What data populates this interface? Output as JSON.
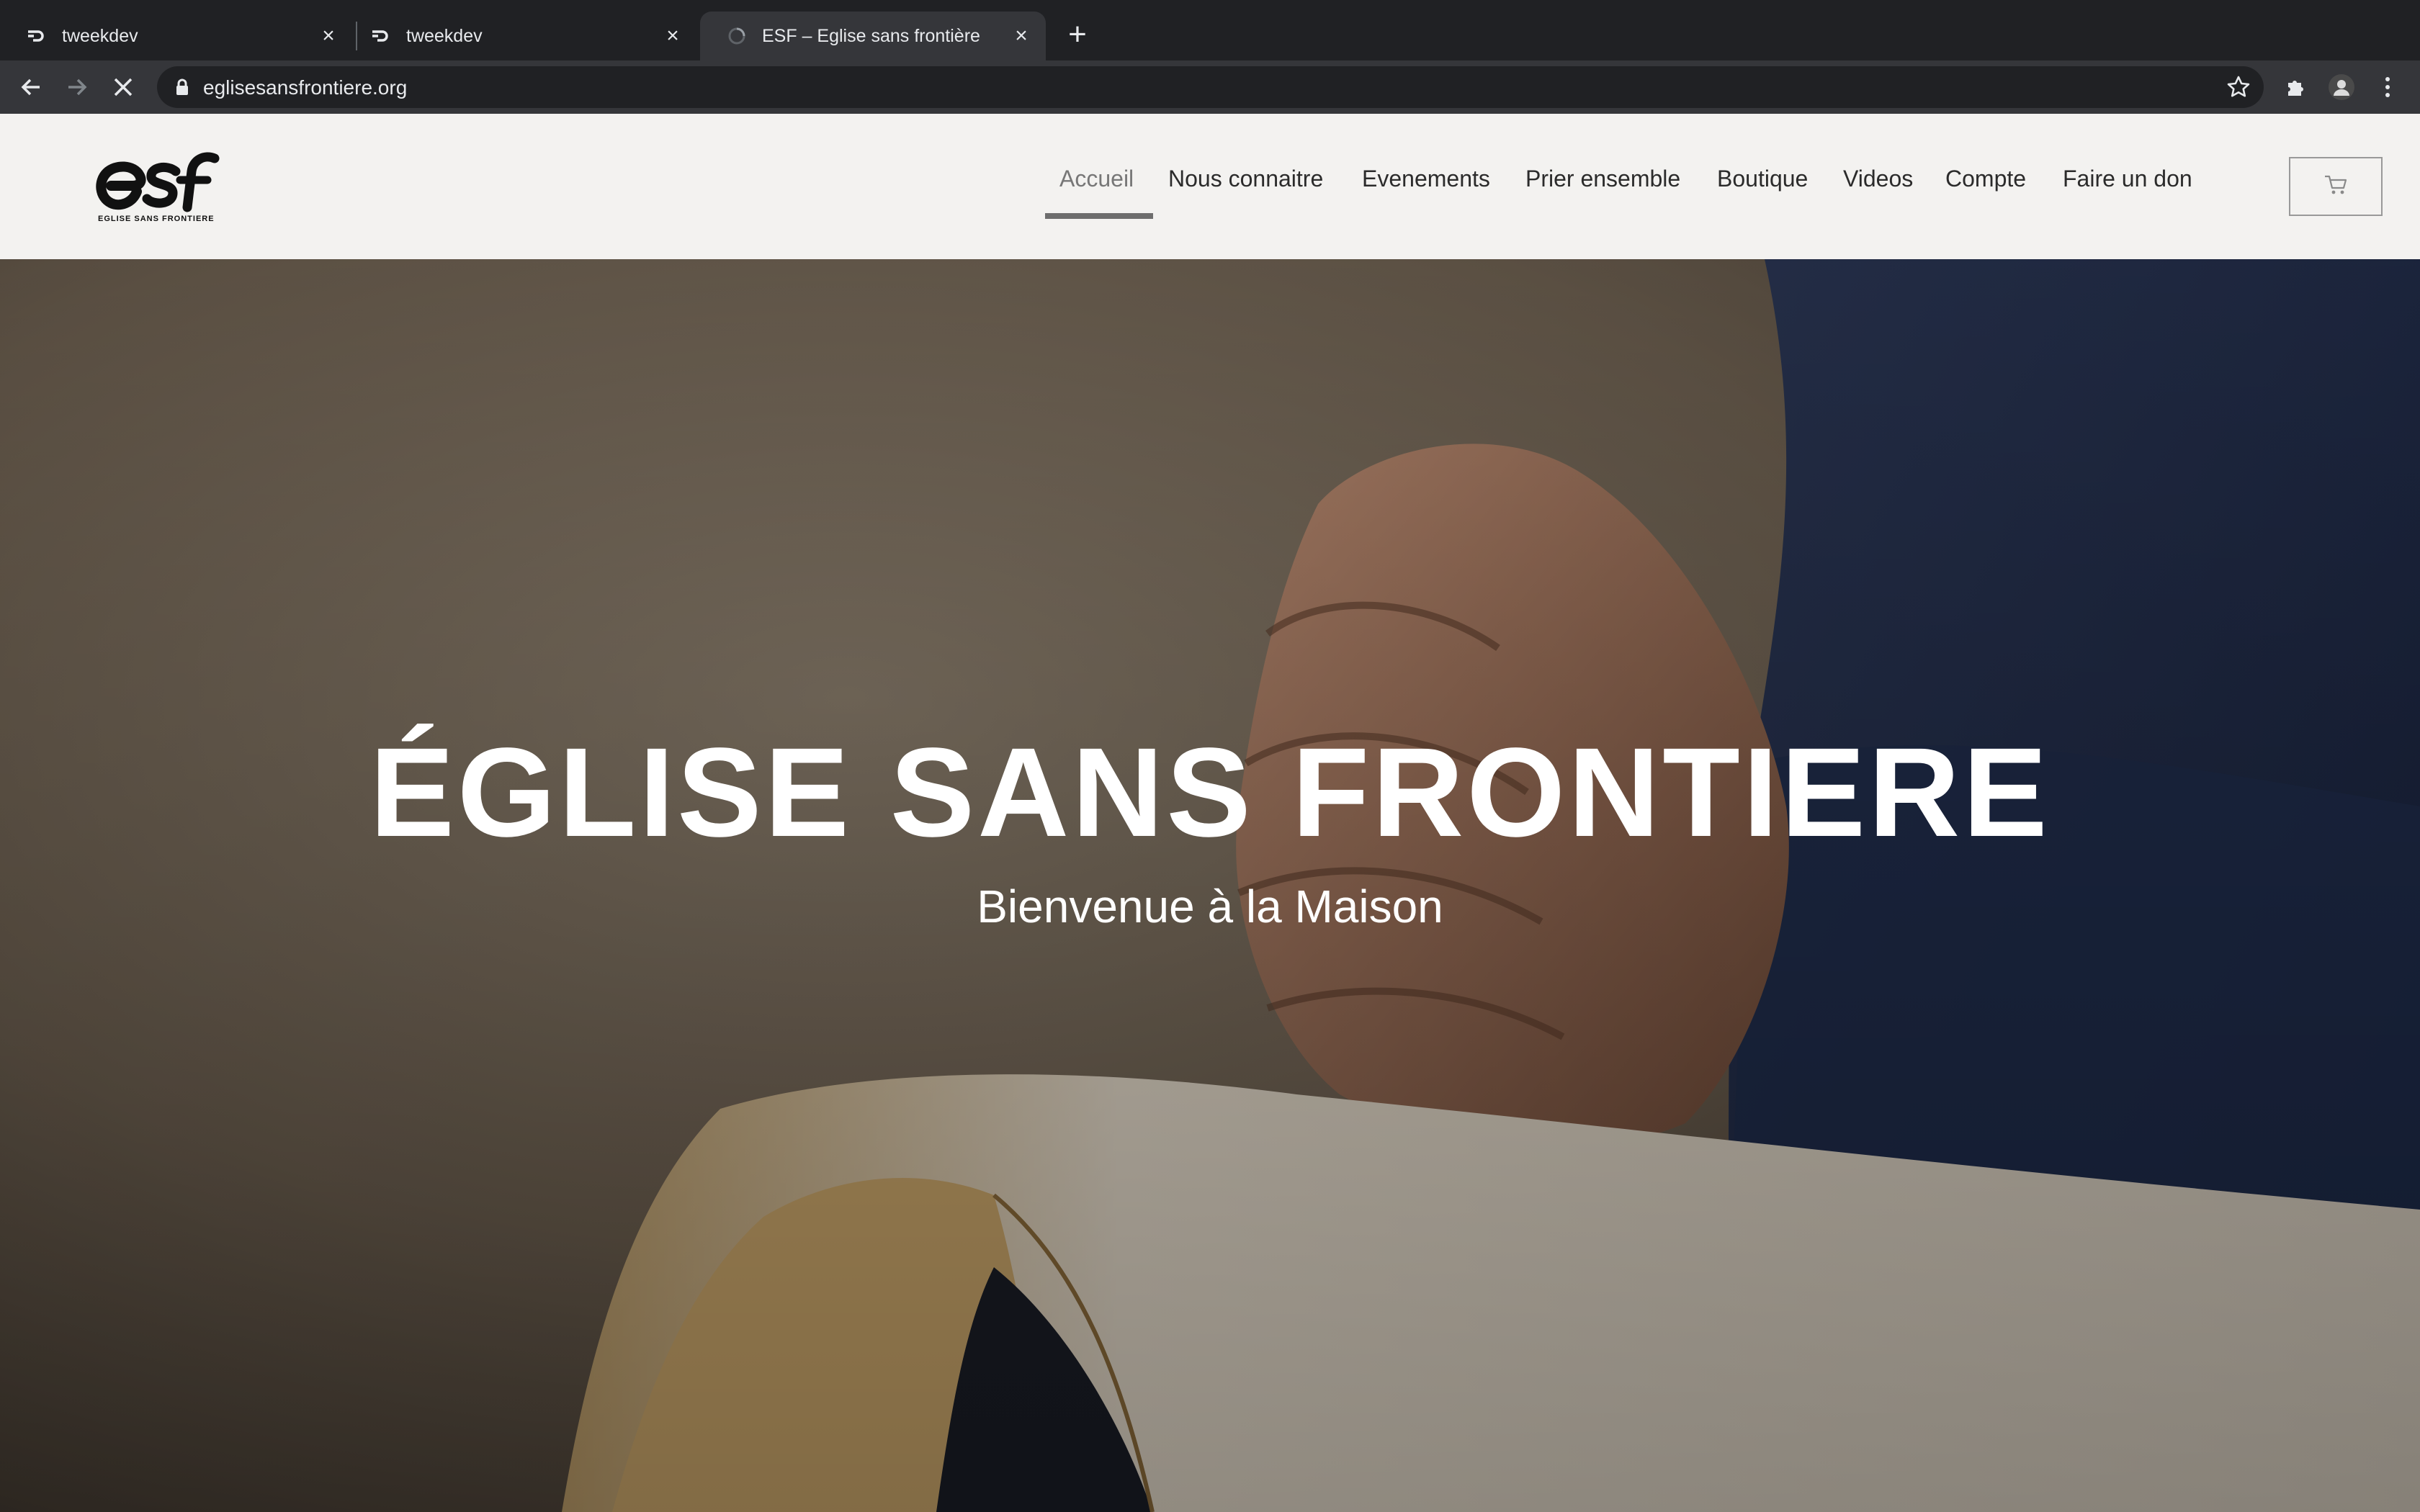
{
  "browser": {
    "tabs": [
      {
        "title": "tweekdev",
        "active": false
      },
      {
        "title": "tweekdev",
        "active": false
      },
      {
        "title": "ESF – Eglise sans frontière",
        "active": true
      }
    ],
    "url": "eglisesansfrontiere.org"
  },
  "site": {
    "logo_text": "EGLISE SANS FRONTIERE",
    "nav": [
      {
        "label": "Accueil",
        "active": true
      },
      {
        "label": "Nous connaitre"
      },
      {
        "label": "Evenements"
      },
      {
        "label": "Prier ensemble"
      },
      {
        "label": "Boutique"
      },
      {
        "label": "Videos"
      },
      {
        "label": "Compte"
      },
      {
        "label": "Faire un don"
      }
    ],
    "cart_icon": "cart-icon"
  },
  "hero": {
    "title": "ÉGLISE SANS FRONTIERE",
    "subtitle": "Bienvenue à la Maison"
  },
  "colors": {
    "chrome_dark": "#202124",
    "chrome_toolbar": "#35363a",
    "header_bg": "#f3f2f0",
    "hero_text": "#ffffff"
  }
}
